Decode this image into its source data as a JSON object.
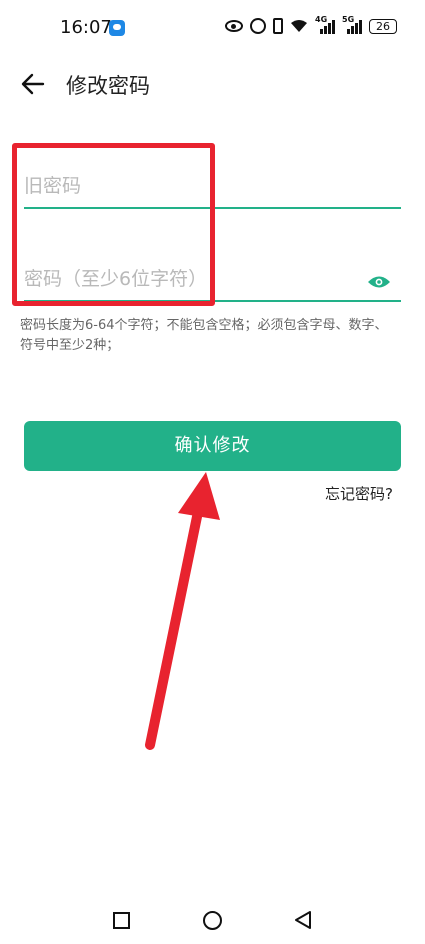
{
  "status_bar": {
    "time": "16:07",
    "network_1": "4G",
    "network_2": "5G",
    "battery": "26"
  },
  "header": {
    "title": "修改密码"
  },
  "form": {
    "old_password_placeholder": "旧密码",
    "new_password_placeholder": "密码（至少6位字符）",
    "hint": "密码长度为6-64个字符；不能包含空格；必须包含字母、数字、符号中至少2种；",
    "confirm_label": "确认修改",
    "forgot_label": "忘记密码?"
  },
  "colors": {
    "accent": "#22b189",
    "annotation": "#e8232f"
  },
  "icons": {
    "back": "arrow-left-icon",
    "toggle_visibility": "eye-icon",
    "nav_recent": "square-icon",
    "nav_home": "circle-icon",
    "nav_back": "triangle-back-icon"
  }
}
